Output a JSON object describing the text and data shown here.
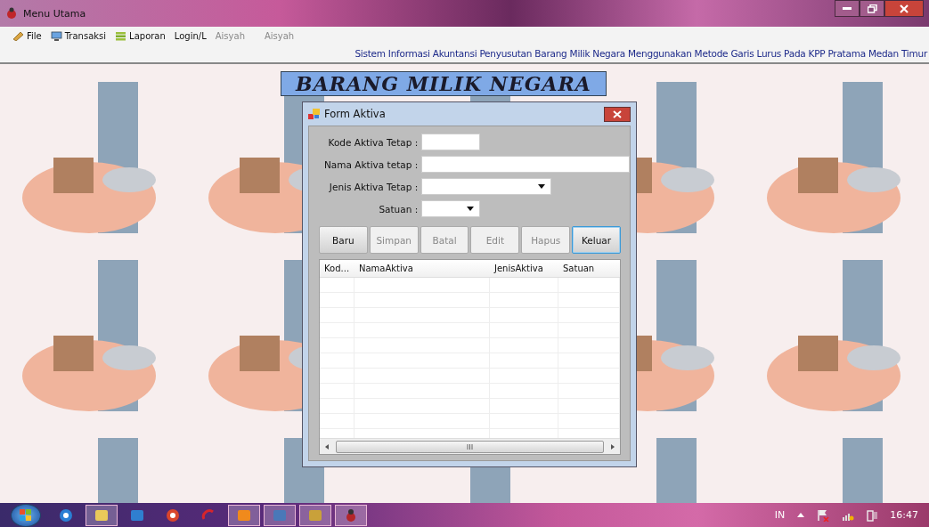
{
  "window": {
    "title": "Menu Utama"
  },
  "menu": [
    {
      "label": "File"
    },
    {
      "label": "Transaksi"
    },
    {
      "label": "Laporan"
    },
    {
      "label": "Login/L"
    }
  ],
  "user_labels": [
    "Aisyah",
    "Aisyah"
  ],
  "status_text": "Sistem Informasi Akuntansi Penyusutan Barang Milik Negara Menggunakan Metode Garis Lurus Pada KPP Pratama Medan Timur",
  "banner": "BARANG MILIK NEGARA",
  "form": {
    "title": "Form Aktiva",
    "fields": [
      {
        "label": "Kode Aktiva Tetap :",
        "kind": "text"
      },
      {
        "label": "Nama Aktiva tetap :",
        "kind": "text"
      },
      {
        "label": "Jenis Aktiva Tetap :",
        "kind": "dropdown"
      },
      {
        "label": "Satuan :",
        "kind": "dropdown"
      }
    ],
    "buttons": [
      {
        "label": "Baru",
        "disabled": false,
        "focused": false
      },
      {
        "label": "Simpan",
        "disabled": true,
        "focused": false
      },
      {
        "label": "Batal",
        "disabled": true,
        "focused": false
      },
      {
        "label": "Edit",
        "disabled": true,
        "focused": false
      },
      {
        "label": "Hapus",
        "disabled": true,
        "focused": false
      },
      {
        "label": "Keluar",
        "disabled": false,
        "focused": true
      }
    ],
    "table": {
      "columns": [
        "Kod...",
        "NamaAktiva",
        "JenisAktiva",
        "Satuan"
      ]
    }
  },
  "taskbar": {
    "apps": [
      {
        "kind": "ie",
        "active": false
      },
      {
        "kind": "folder",
        "active": true
      },
      {
        "kind": "media",
        "active": false
      },
      {
        "kind": "chrome",
        "active": false
      },
      {
        "kind": "swirl",
        "active": false
      },
      {
        "kind": "antivirus",
        "active": true
      },
      {
        "kind": "editor",
        "active": true
      },
      {
        "kind": "tools",
        "active": true
      },
      {
        "kind": "bug",
        "active": true
      }
    ],
    "language": "IN",
    "clock": "16:47"
  }
}
